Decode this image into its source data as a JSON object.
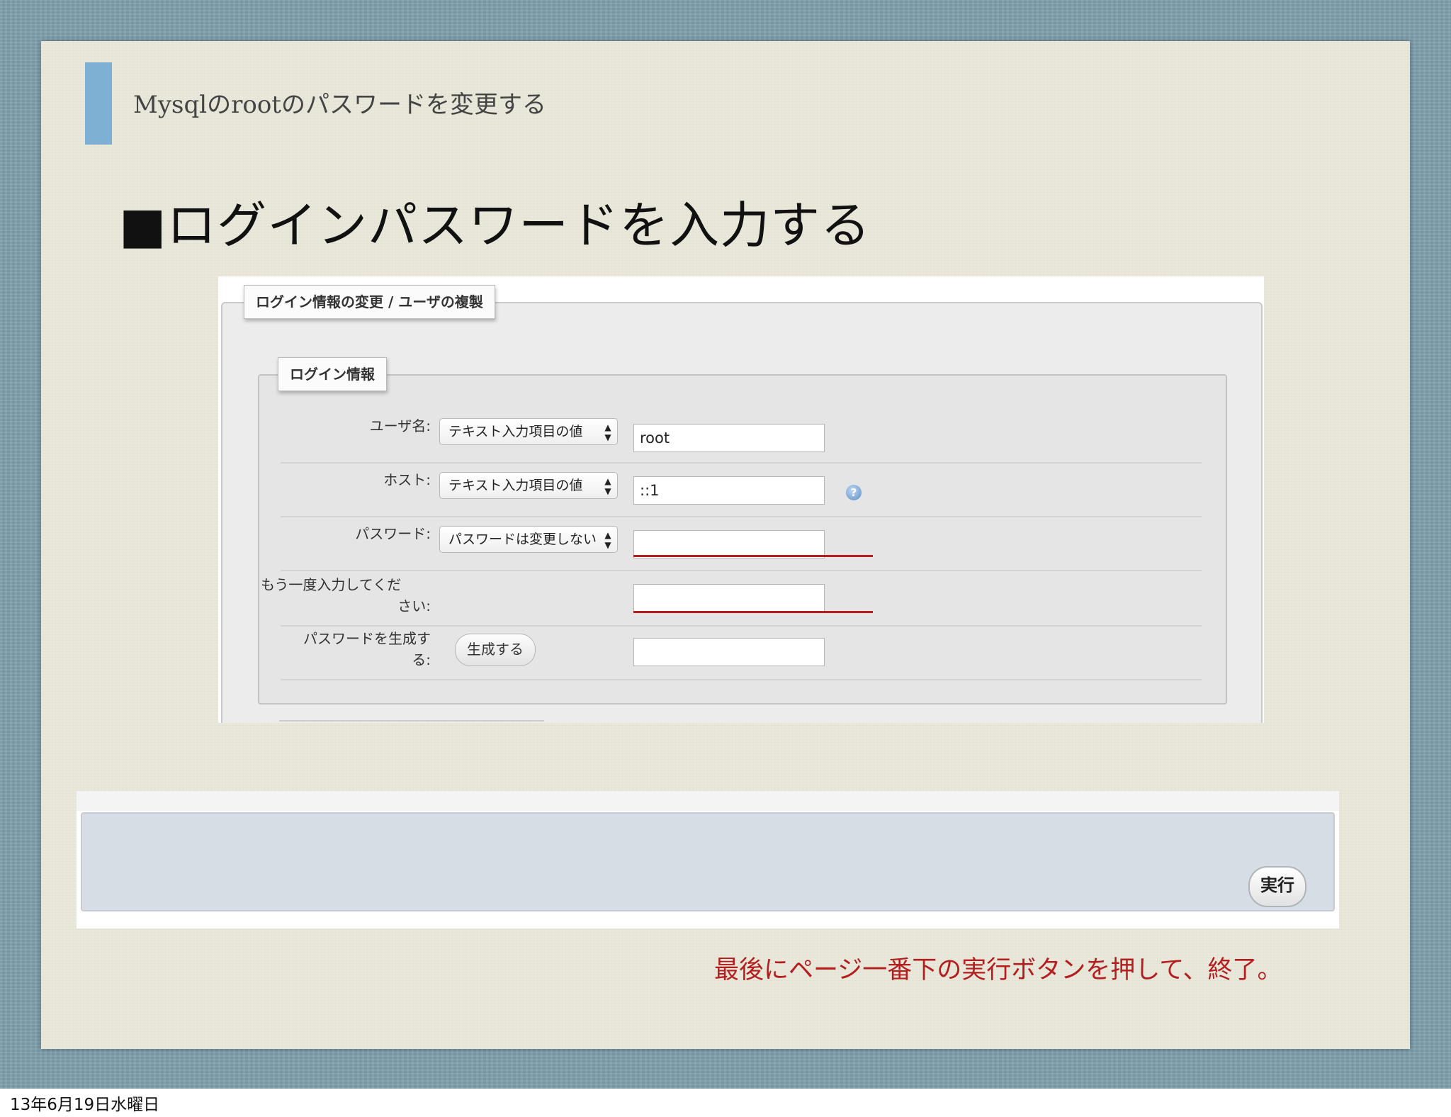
{
  "slide": {
    "header": "Mysqlのrootのパスワードを変更する",
    "title": "■ログインパスワードを入力する",
    "caption": "最後にページ一番下の実行ボタンを押して、終了。",
    "footer_date": "13年6月19日水曜日",
    "colors": {
      "accent_bar": "#7eb0d4",
      "caption": "#b41e1e",
      "highlight_line": "#b41e1e"
    }
  },
  "form": {
    "outer_legend": "ログイン情報の変更 / ユーザの複製",
    "inner_legend": "ログイン情報",
    "rows": [
      {
        "label": "ユーザ名:",
        "select": "テキスト入力項目の値",
        "input": "root"
      },
      {
        "label": "ホスト:",
        "select": "テキスト入力項目の値",
        "input": "::1",
        "help_icon": "help-icon"
      },
      {
        "label": "パスワード:",
        "select": "パスワードは変更しない",
        "input": ""
      },
      {
        "label_line1": "もう一度入力してくだ",
        "label_line2": "さい:",
        "input": ""
      },
      {
        "label_line1": "パスワードを生成す",
        "label_line2": "る:",
        "button": "生成する",
        "input": ""
      }
    ]
  },
  "footer_bar": {
    "exec_button": "実行"
  }
}
